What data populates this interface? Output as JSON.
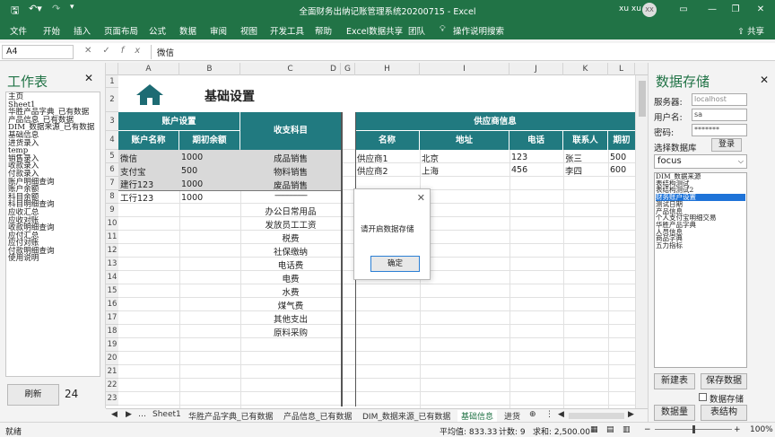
{
  "titlebar": {
    "title": "全面财务出纳记账管理系统20200715  -  Excel",
    "user": "xu xu",
    "avatar": "XX",
    "save_icon": "save-icon",
    "undo_icon": "undo-icon",
    "redo_icon": "redo-icon"
  },
  "ribbon": {
    "tabs": [
      "文件",
      "开始",
      "插入",
      "页面布局",
      "公式",
      "数据",
      "审阅",
      "视图",
      "开发工具",
      "帮助",
      "Excel数据共享",
      "团队"
    ],
    "search": "操作说明搜索",
    "share": "共享"
  },
  "formula_bar": {
    "name_box": "A4",
    "formula": "微信"
  },
  "left_pane": {
    "title": "工作表",
    "sheets": [
      "主页",
      "Sheet1",
      "华胜产品字典_已有数据",
      "产品信息_已有数据",
      "DIM_数据来源_已有数据",
      "基础信息",
      "进货录入",
      "temp",
      "销售录入",
      "收款录入",
      "付款录入",
      "账户明细查询",
      "账户余额",
      "科目余额",
      "科目明细查询",
      "应收汇总",
      "应收对账",
      "收款明细查询",
      "应付汇总",
      "应付对账",
      "付款明细查询",
      "使用说明"
    ],
    "refresh": "刷新",
    "count": "24"
  },
  "sheet": {
    "col_headers": [
      "A",
      "B",
      "C",
      "",
      "D",
      "E",
      "",
      "H",
      "I",
      "J",
      "K",
      "L"
    ],
    "title": "基础设置",
    "account_header": "账户设置",
    "col_account": "账户名称",
    "col_initial": "期初余额",
    "col_subject": "收支科目",
    "accounts": [
      {
        "name": "微信",
        "balance": "1000",
        "subject": "成品销售"
      },
      {
        "name": "支付宝",
        "balance": "500",
        "subject": "物料销售"
      },
      {
        "name": "建行123",
        "balance": "1000",
        "subject": "废品销售"
      },
      {
        "name": "工行123",
        "balance": "1000",
        "subject": "----------------"
      }
    ],
    "subjects_extra": [
      "办公日常用品",
      "发放员工工资",
      "税费",
      "社保缴纳",
      "电话费",
      "电费",
      "水费",
      "煤气费",
      "其他支出",
      "原料采购"
    ],
    "supplier_header": "供应商信息",
    "supplier_cols": [
      "名称",
      "地址",
      "电话",
      "联系人",
      "期初"
    ],
    "suppliers": [
      {
        "name": "供应商1",
        "addr": "北京",
        "phone": "123",
        "contact": "张三",
        "init": "500"
      },
      {
        "name": "供应商2",
        "addr": "上海",
        "phone": "456",
        "contact": "李四",
        "init": "600"
      }
    ],
    "home_icon": "home-icon"
  },
  "dialog": {
    "message": "请开启数据存储",
    "ok": "确定"
  },
  "right_pane": {
    "title": "数据存储",
    "server_label": "服务器:",
    "server_value": "localhost",
    "user_label": "用户名:",
    "user_value": "sa",
    "pwd_label": "密码:",
    "pwd_value": "*******",
    "db_label": "选择数据库",
    "login": "登录",
    "db_value": "focus",
    "tables": [
      "DIM_数据来源",
      "表结构测试",
      "表结构测试2",
      "财务账户设置",
      "测试日期",
      "产品信息",
      "个人支付宝明细交易",
      "华胜产品字典",
      "人员信息",
      "商品字典",
      "五力指标"
    ],
    "selected_table": "财务账户设置",
    "new_table": "新建表",
    "save_data": "保存数据",
    "store_checkbox": "数据存储",
    "data_count": "数据量",
    "structure": "表结构"
  },
  "tabs": {
    "items": [
      "Sheet1",
      "华胜产品字典_已有数据",
      "产品信息_已有数据",
      "DIM_数据来源_已有数据",
      "基础信息",
      "进货"
    ],
    "active": "基础信息"
  },
  "status": {
    "ready": "就绪",
    "avg": "平均值: 833.33",
    "count": "计数: 9",
    "sum": "求和: 2,500.00",
    "zoom": "100%"
  }
}
